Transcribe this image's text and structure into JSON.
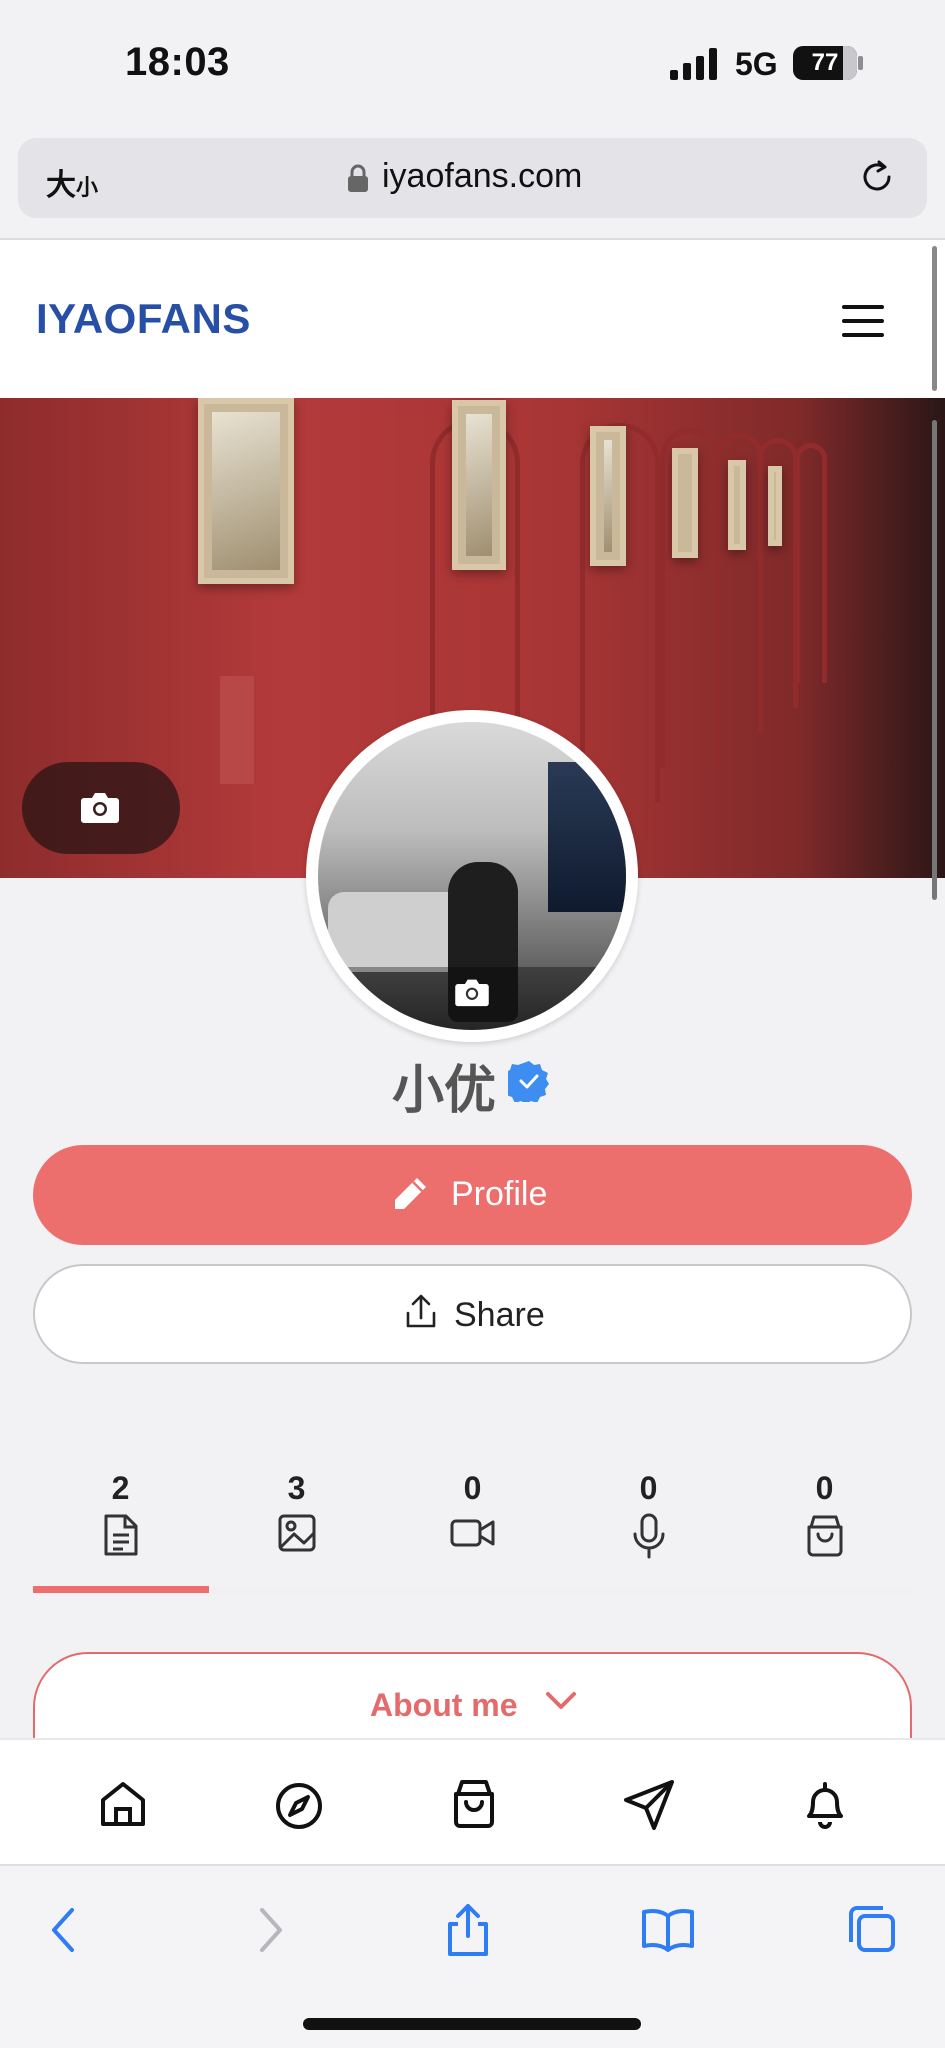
{
  "status_bar": {
    "time": "18:03",
    "network": "5G",
    "battery": "77"
  },
  "browser": {
    "text_size_label": "大",
    "text_size_small": "小",
    "url": "iyaofans.com"
  },
  "site": {
    "logo": "IYAOFANS"
  },
  "profile": {
    "name": "小优",
    "profile_button": "Profile",
    "share_button": "Share",
    "about_me": "About me"
  },
  "tabs": [
    {
      "count": "2",
      "icon": "document-icon"
    },
    {
      "count": "3",
      "icon": "image-icon"
    },
    {
      "count": "0",
      "icon": "video-icon"
    },
    {
      "count": "0",
      "icon": "microphone-icon"
    },
    {
      "count": "0",
      "icon": "shopping-bag-icon"
    }
  ],
  "bottom_nav": [
    "home-icon",
    "compass-icon",
    "shopping-bag-icon",
    "send-icon",
    "bell-icon"
  ],
  "safari_toolbar": [
    "back-icon",
    "forward-icon",
    "share-icon",
    "bookmarks-icon",
    "tabs-icon"
  ],
  "colors": {
    "accent": "#ec6e6d",
    "logo": "#284fa6",
    "verified": "#3d8ef0"
  }
}
